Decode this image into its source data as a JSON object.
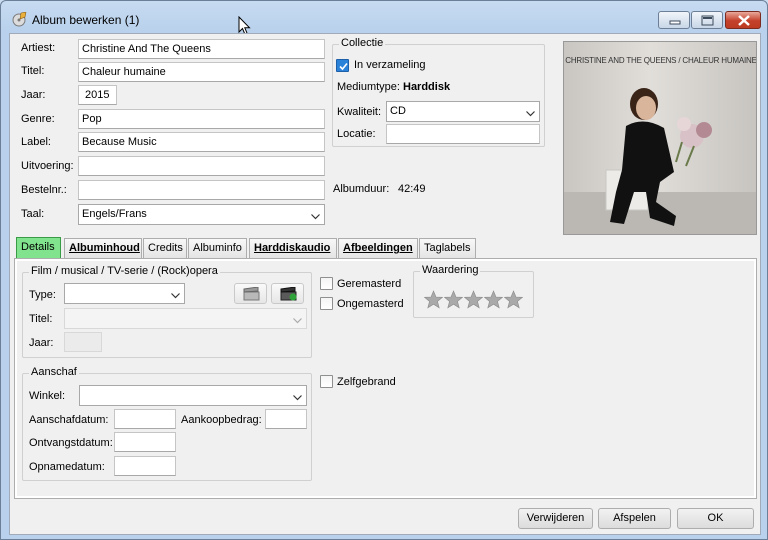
{
  "window": {
    "title": "Album bewerken (1)"
  },
  "album": {
    "artist_label": "Artiest:",
    "artist": "Christine And The Queens",
    "title_label": "Titel:",
    "title": "Chaleur humaine",
    "year_label": "Jaar:",
    "year": "2015",
    "genre_label": "Genre:",
    "genre": "Pop",
    "label_label": "Label:",
    "label": "Because Music",
    "performance_label": "Uitvoering:",
    "performance": "",
    "order_label": "Bestelnr.:",
    "order": "",
    "language_label": "Taal:",
    "language": "Engels/Frans"
  },
  "collection": {
    "group_title": "Collectie",
    "in_collection_label": "In verzameling",
    "in_collection_checked": true,
    "mediatype_label": "Mediumtype:",
    "mediatype": "Harddisk",
    "quality_label": "Kwaliteit:",
    "quality": "CD",
    "location_label": "Locatie:",
    "location": ""
  },
  "duration": {
    "label": "Albumduur:",
    "value": "42:49"
  },
  "cover": {
    "caption": "CHRISTINE AND THE QUEENS / CHALEUR HUMAINE"
  },
  "tabs": [
    {
      "label": "Details",
      "active": true,
      "bold": false
    },
    {
      "label": "Albuminhoud",
      "active": false,
      "bold": true
    },
    {
      "label": "Credits",
      "active": false,
      "bold": false
    },
    {
      "label": "Albuminfo",
      "active": false,
      "bold": false
    },
    {
      "label": "Harddiskaudio",
      "active": false,
      "bold": true
    },
    {
      "label": "Afbeeldingen",
      "active": false,
      "bold": true
    },
    {
      "label": "Taglabels",
      "active": false,
      "bold": false
    }
  ],
  "details": {
    "film_group": "Film / musical / TV-serie / (Rock)opera",
    "type_label": "Type:",
    "type": "",
    "film_title_label": "Titel:",
    "film_title": "",
    "film_year_label": "Jaar:",
    "film_year": "",
    "remastered_label": "Geremasterd",
    "unremastered_label": "Ongemasterd",
    "rating_group": "Waardering",
    "rating": 0,
    "rating_max": 5,
    "purchase_group": "Aanschaf",
    "shop_label": "Winkel:",
    "shop": "",
    "purchase_date_label": "Aanschafdatum:",
    "purchase_date": "",
    "price_label": "Aankoopbedrag:",
    "price": "",
    "receipt_date_label": "Ontvangstdatum:",
    "receipt_date": "",
    "recording_date_label": "Opnamedatum:",
    "recording_date": "",
    "selfmade_label": "Zelfgebrand"
  },
  "footer": {
    "delete_label": "Verwijderen",
    "play_label": "Afspelen",
    "ok_label": "OK"
  },
  "colors": {
    "active_tab": "#82e38e",
    "check_accent": "#2b82d9",
    "close_button": "#c4402b"
  }
}
